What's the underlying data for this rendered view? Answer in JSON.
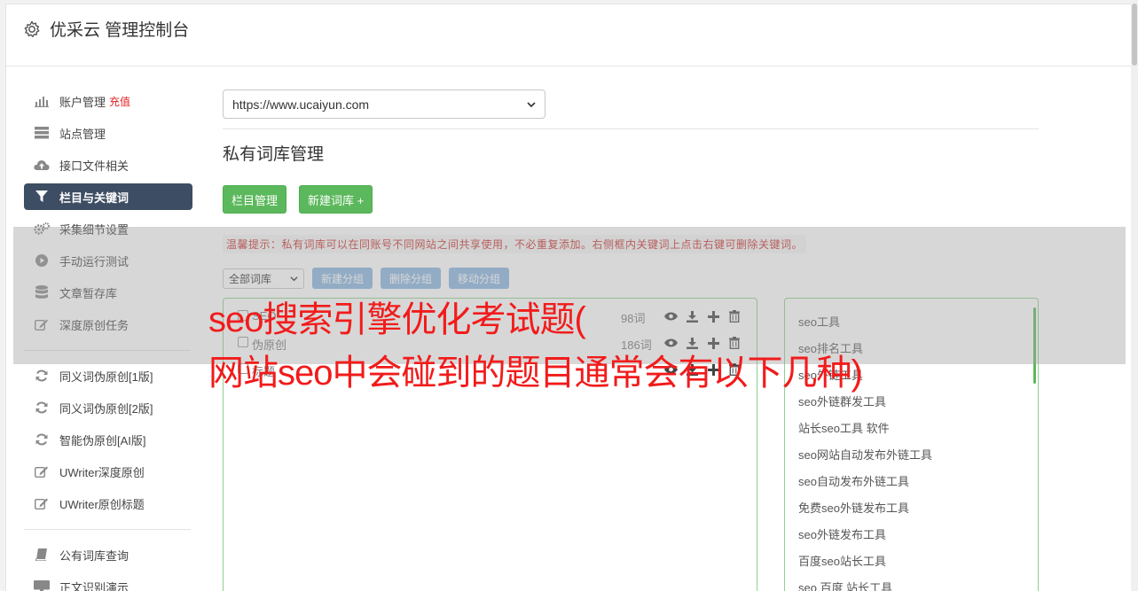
{
  "header": {
    "title": "优采云 管理控制台",
    "icon": "gear-icon"
  },
  "sidebar": {
    "items": [
      {
        "label": "账户管理",
        "badge": "充值",
        "icon": "bar-chart-icon"
      },
      {
        "label": "站点管理",
        "icon": "server-icon"
      },
      {
        "label": "接口文件相关",
        "icon": "cloud-upload-icon"
      },
      {
        "label": "栏目与关键词",
        "icon": "filter-icon",
        "active": true
      },
      {
        "label": "采集细节设置",
        "icon": "cogs-icon"
      },
      {
        "label": "手动运行测试",
        "icon": "play-circle-icon"
      },
      {
        "label": "文章暂存库",
        "icon": "database-icon"
      },
      {
        "label": "深度原创任务",
        "icon": "edit-icon"
      }
    ],
    "items2": [
      {
        "label": "同义词伪原创[1版]",
        "icon": "refresh-icon"
      },
      {
        "label": "同义词伪原创[2版]",
        "icon": "refresh-icon"
      },
      {
        "label": "智能伪原创[AI版]",
        "icon": "refresh-icon"
      },
      {
        "label": "UWriter深度原创",
        "icon": "edit-icon"
      },
      {
        "label": "UWriter原创标题",
        "icon": "edit-icon"
      }
    ],
    "items3": [
      {
        "label": "公有词库查询",
        "icon": "book-icon"
      },
      {
        "label": "正文识别演示",
        "icon": "monitor-icon"
      }
    ]
  },
  "main": {
    "site_select": "https://www.ucaiyun.com",
    "section_title": "私有词库管理",
    "btn_column": "栏目管理",
    "btn_new_lib": "新建词库 +",
    "tip": "温馨提示：私有词库可以在同账号不同网站之间共享使用，不必重复添加。右侧框内关键词上点击右键可删除关键词。",
    "all_libs": "全部词库",
    "btn_new_group": "新建分组",
    "btn_delete_group": "删除分组",
    "btn_move_group": "移动分组",
    "libraries": [
      {
        "name": "SEO",
        "count": "98词"
      },
      {
        "name": "伪原创",
        "count": "186词"
      },
      {
        "name": "标题",
        "count": ""
      }
    ],
    "keywords": [
      "seo工具",
      "seo排名工具",
      "seo外链工具",
      "seo外链群发工具",
      "站长seo工具 软件",
      "seo网站自动发布外链工具",
      "seo自动发布外链工具",
      "免费seo外链发布工具",
      "seo外链发布工具",
      "百度seo站长工具",
      "seo 百度 站长工具"
    ]
  },
  "overlay": {
    "line1": "seo搜索引擎优化考试题(",
    "line2": "网站seo中会碰到的题目通常会有以下几种)"
  },
  "colors": {
    "accent_green": "#5cb85c",
    "nav_active": "#3d4d63",
    "headline_red": "#f21b1b"
  }
}
